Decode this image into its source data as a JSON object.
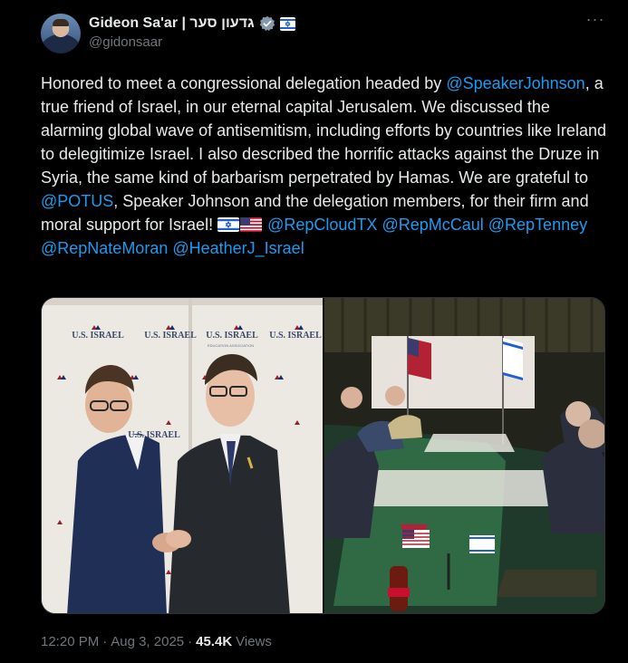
{
  "author": {
    "display_name": "Gideon Sa'ar | גדעון סער",
    "handle": "@gidonsaar",
    "avatar_icon": "profile-photo",
    "verified_icon": "verified-badge-icon",
    "affiliate_icon": "israel-flag-badge-icon"
  },
  "tweet": {
    "text_parts": {
      "p1": "Honored to meet a congressional delegation headed by ",
      "m1": "@SpeakerJohnson",
      "p2": ", a true friend of Israel, in our eternal capital Jerusalem. We discussed the alarming global wave of antisemitism, including efforts by countries like Ireland to delegitimize Israel. I also described the horrific attacks against the Druze in Syria, the same kind of barbarism perpetrated by Hamas. We are grateful to ",
      "m2": "@POTUS",
      "p3": ", Speaker Johnson and the delegation members, for their firm and moral support for Israel! ",
      "m3": "@RepCloudTX",
      "m4": "@RepMcCaul",
      "m5": "@RepTenney",
      "m6": "@RepNateMoran",
      "m7": "@HeatherJ_Israel"
    },
    "emojis": [
      "israel-flag-emoji",
      "us-flag-emoji"
    ],
    "backdrop_text": "U.S. ISRAEL",
    "backdrop_subtext": "EDUCATION ASSOCIATION"
  },
  "meta": {
    "time": "12:20 PM",
    "separator": "·",
    "date": "Aug 3, 2025",
    "views_count": "45.4K",
    "views_label": "Views"
  },
  "colors": {
    "background": "#000000",
    "text": "#e7e9ea",
    "secondary": "#71767b",
    "link": "#1d9bf0"
  }
}
